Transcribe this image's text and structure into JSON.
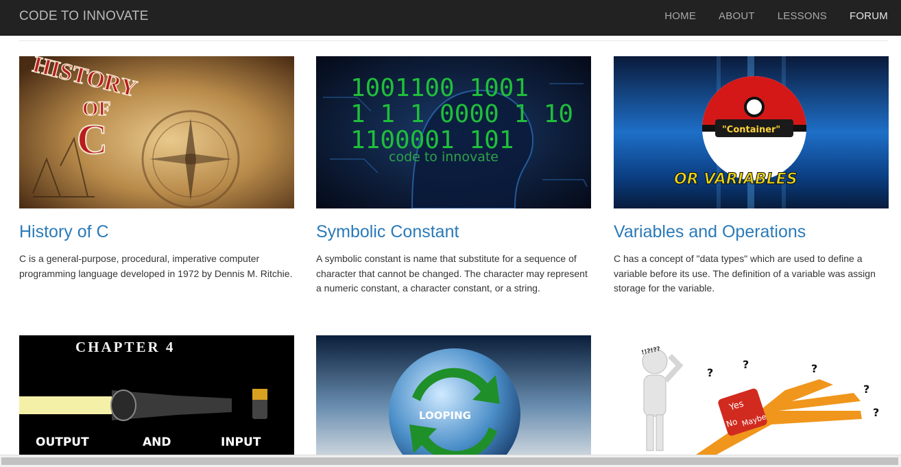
{
  "brand": "CODE TO INNOVATE",
  "nav": [
    "HOME",
    "ABOUT",
    "LESSONS",
    "FORUM"
  ],
  "cards": [
    {
      "title": "History of C",
      "text": "C is a general-purpose, procedural, imperative computer programming language developed in 1972 by Dennis M. Ritchie.",
      "image_text": [
        "HISTORY",
        "OF",
        "C"
      ]
    },
    {
      "title": "Symbolic Constant",
      "text": "A symbolic constant is name that substitute for a sequence of character that cannot be changed. The character may represent a numeric constant, a character constant, or a string.",
      "image_text": [
        "1001100 1001",
        "1 1 1 0000 1 10",
        "1100001 101",
        "code to innovate"
      ]
    },
    {
      "title": "Variables and Operations",
      "text": "C has a concept of \"data types\" which are used to define a variable before its use. The definition of a variable was assign storage for the variable.",
      "image_text": [
        "\"Container\"",
        "OR VARIABLES"
      ]
    },
    {
      "image_text": [
        "CHAPTER 4",
        "OUTPUT",
        "AND",
        "INPUT"
      ]
    },
    {
      "image_text": [
        "LOOPING"
      ]
    },
    {
      "image_text": [
        "!!?!??",
        "?",
        "?",
        "?",
        "?",
        "?",
        "Yes",
        "No",
        "Maybe"
      ]
    }
  ]
}
